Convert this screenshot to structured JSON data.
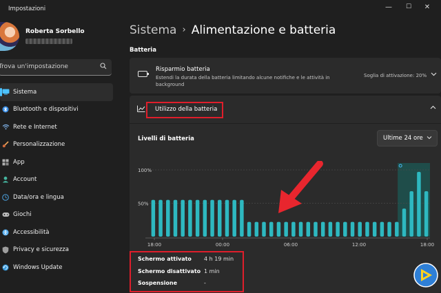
{
  "window": {
    "title": "Impostazioni",
    "minimize": "—",
    "maximize": "☐",
    "close": "✕"
  },
  "profile": {
    "name": "Roberta Sorbello"
  },
  "search": {
    "placeholder": "Trova un'impostazione"
  },
  "sidebar": {
    "items": [
      {
        "label": "Sistema",
        "icon": "system-icon",
        "color": "#4cc2ff",
        "active": true
      },
      {
        "label": "Bluetooth e dispositivi",
        "icon": "bluetooth-icon",
        "color": "#3a8ee6"
      },
      {
        "label": "Rete e Internet",
        "icon": "wifi-icon",
        "color": "#7fb2e8"
      },
      {
        "label": "Personalizzazione",
        "icon": "brush-icon",
        "color": "#e8a25b"
      },
      {
        "label": "App",
        "icon": "apps-icon",
        "color": "#b0b0b0"
      },
      {
        "label": "Account",
        "icon": "account-icon",
        "color": "#46b6a0"
      },
      {
        "label": "Data/ora e lingua",
        "icon": "globe-clock-icon",
        "color": "#4ca3e0"
      },
      {
        "label": "Giochi",
        "icon": "gamepad-icon",
        "color": "#bdbdbd"
      },
      {
        "label": "Accessibilità",
        "icon": "accessibility-icon",
        "color": "#5ab0f0"
      },
      {
        "label": "Privacy e sicurezza",
        "icon": "shield-icon",
        "color": "#9e9e9e"
      },
      {
        "label": "Windows Update",
        "icon": "update-icon",
        "color": "#3b9de0"
      }
    ]
  },
  "header": {
    "parent": "Sistema",
    "separator": "›",
    "title": "Alimentazione e batteria"
  },
  "section": {
    "label": "Batteria"
  },
  "saver": {
    "title": "Risparmio batteria",
    "description": "Estendi la durata della batteria limitando alcune notifiche e le attività in background",
    "threshold": "Soglia di attivazione: 20%",
    "icon": "battery-saver-icon"
  },
  "usage": {
    "title": "Utilizzo della batteria",
    "levels_title": "Livelli di batteria",
    "range": "Ultime 24 ore"
  },
  "chart_data": {
    "type": "bar",
    "title": "Livelli di batteria",
    "x_tick_labels": [
      "18:00",
      "00:00",
      "06:00",
      "12:00",
      "18:00"
    ],
    "y_tick_labels": [
      "100%",
      "50%"
    ],
    "ylim": [
      0,
      100
    ],
    "grid": true,
    "bar_color": "#2eb8c0",
    "highlight_color": "#1c5a55",
    "values": [
      55,
      55,
      55,
      55,
      55,
      55,
      55,
      55,
      55,
      55,
      55,
      55,
      55,
      22,
      22,
      22,
      22,
      22,
      22,
      22,
      22,
      22,
      22,
      22,
      22,
      22,
      22,
      22,
      22,
      22,
      22,
      22,
      22,
      22,
      42,
      68,
      97,
      68
    ],
    "highlighted_from_index": 34
  },
  "stats": [
    {
      "label": "Schermo attivato",
      "value": "4 h 19 min"
    },
    {
      "label": "Schermo disattivato",
      "value": "1 min"
    },
    {
      "label": "Sospensione",
      "value": "-"
    }
  ],
  "annotations": {
    "highlight_color": "#e01e2b",
    "arrow_color": "#e8262e"
  }
}
